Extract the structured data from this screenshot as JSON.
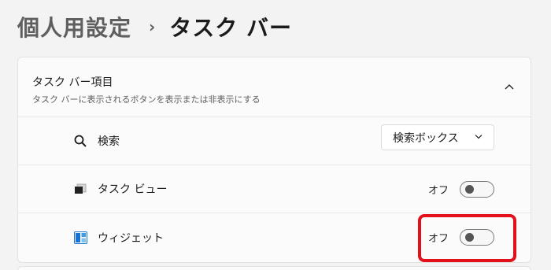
{
  "breadcrumb": {
    "parent": "個人用設定",
    "separator": "›",
    "current": "タスク バー"
  },
  "section": {
    "title": "タスク バー項目",
    "subtitle": "タスク バーに表示されるボタンを表示または非表示にする",
    "collapse_icon": "chevron-up-icon"
  },
  "items": [
    {
      "label": "検索",
      "icon": "search-icon",
      "control": "dropdown",
      "value": "検索ボックス"
    },
    {
      "label": "タスク ビュー",
      "icon": "task-view-icon",
      "control": "toggle",
      "state_label": "オフ",
      "on": false
    },
    {
      "label": "ウィジェット",
      "icon": "widgets-icon",
      "control": "toggle",
      "state_label": "オフ",
      "on": false
    }
  ],
  "colors": {
    "accent_highlight": "#e3101a",
    "widgets_icon": "#1a73d1"
  }
}
